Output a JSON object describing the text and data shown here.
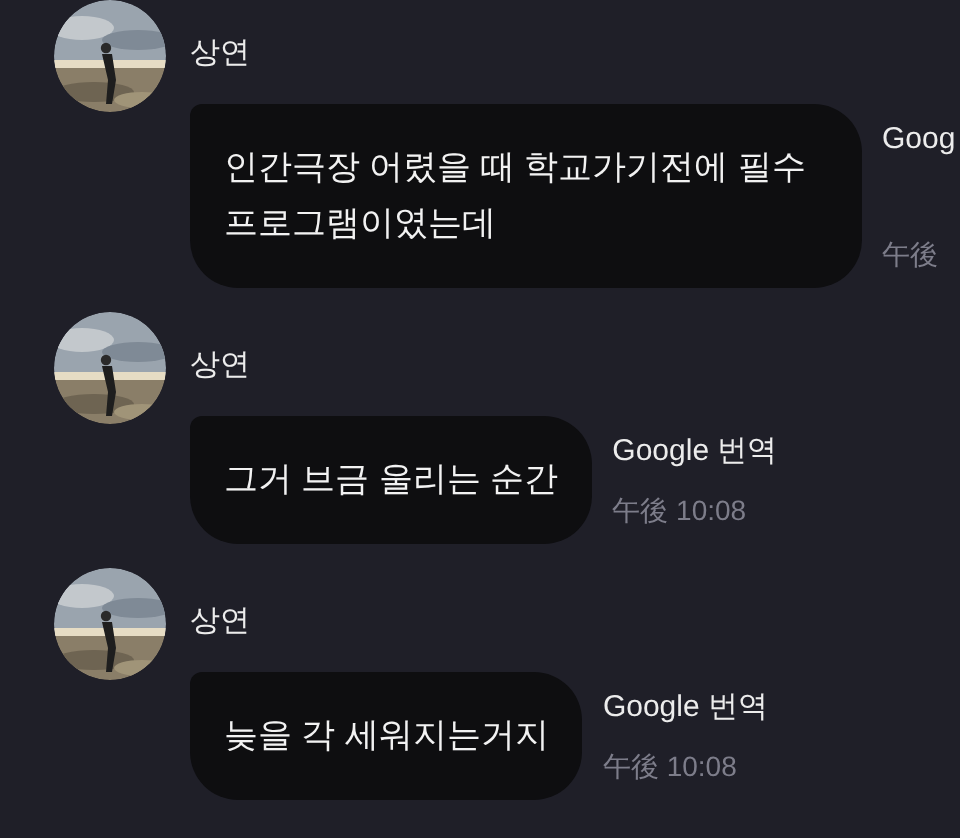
{
  "messages": [
    {
      "sender": "상연",
      "text": "인간극장 어렸을 때 학교가기전에 필수 프로그램이였는데",
      "translate": "Goog",
      "time": "午後"
    },
    {
      "sender": "상연",
      "text": "그거 브금 울리는 순간",
      "translate": "Google 번역",
      "time": "午後 10:08"
    },
    {
      "sender": "상연",
      "text": "늦을 각 세워지는거지",
      "translate": "Google 번역",
      "time": "午後 10:08"
    }
  ]
}
